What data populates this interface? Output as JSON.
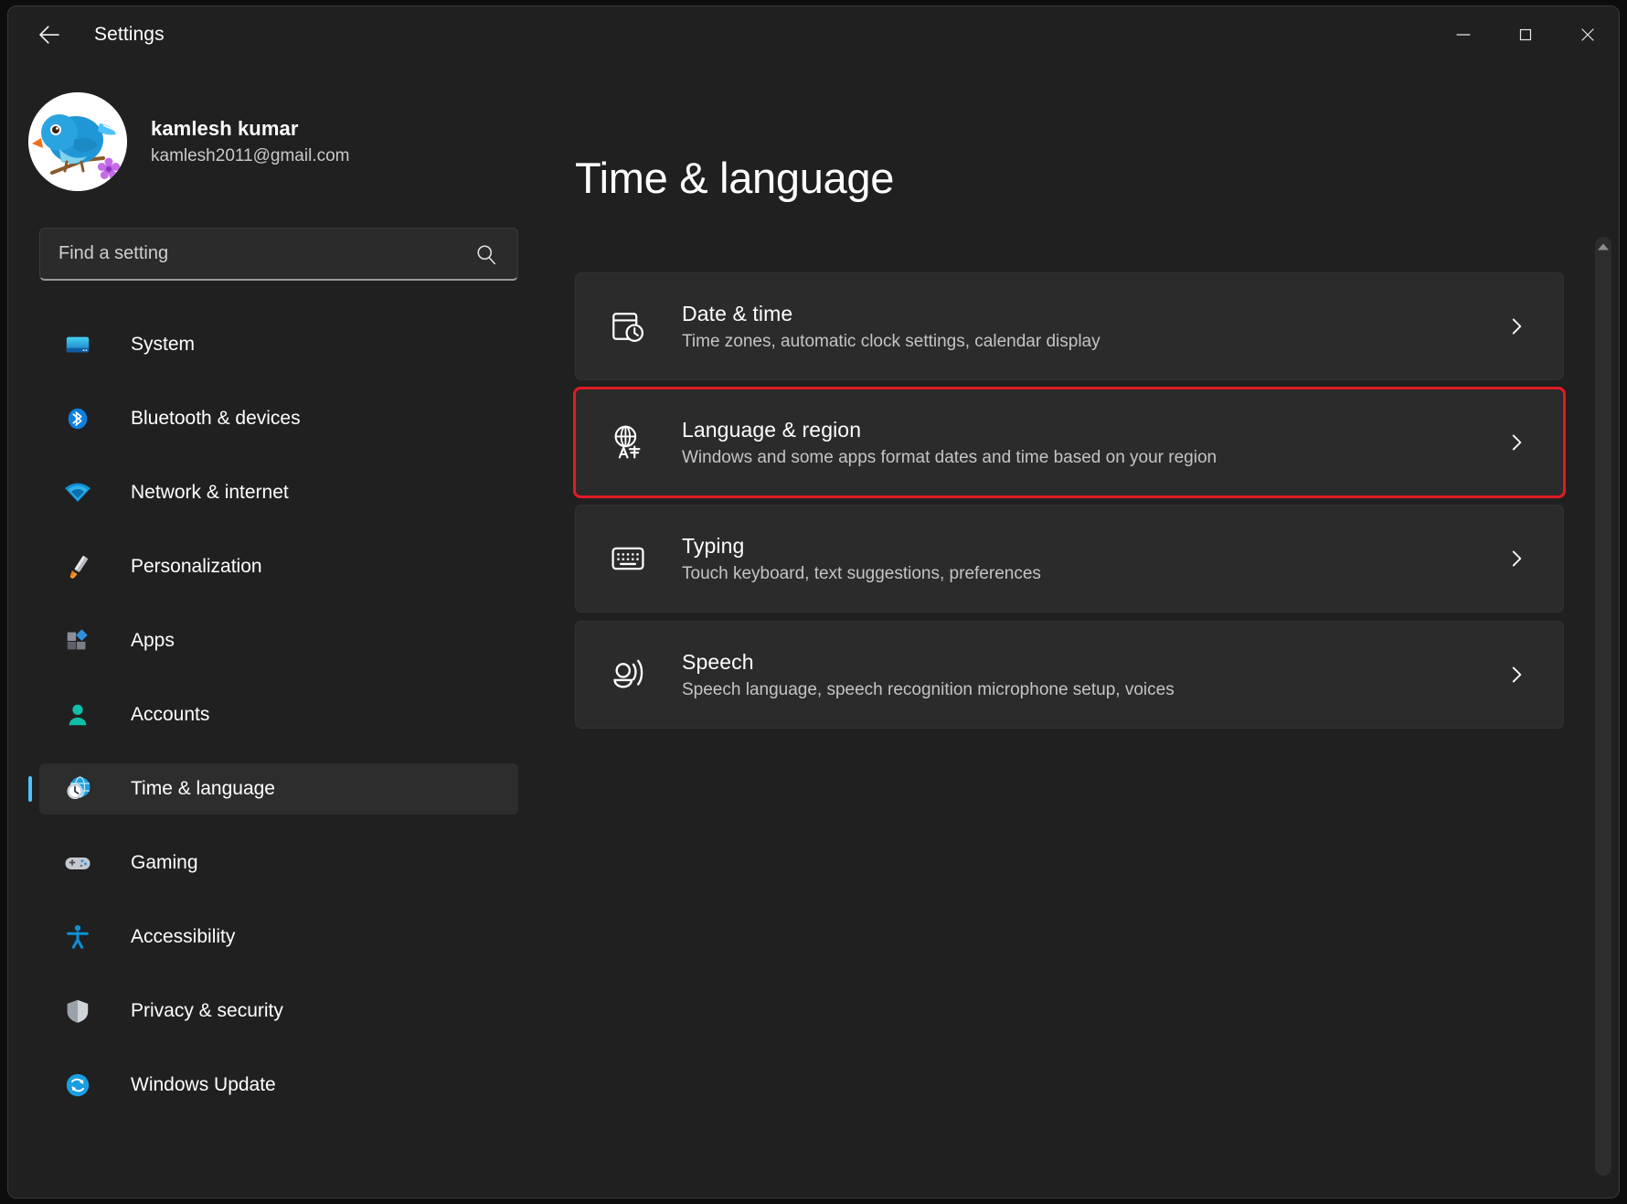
{
  "window": {
    "app_title": "Settings",
    "back_label": "Back",
    "controls": {
      "minimize": "Minimize",
      "maximize": "Maximize",
      "close": "Close"
    }
  },
  "account": {
    "name": "kamlesh kumar",
    "email": "kamlesh2011@gmail.com",
    "avatar_alt": "blue bird avatar"
  },
  "search": {
    "placeholder": "Find a setting",
    "value": ""
  },
  "sidebar": {
    "items": [
      {
        "label": "System",
        "icon": "monitor-icon",
        "selected": false
      },
      {
        "label": "Bluetooth & devices",
        "icon": "bluetooth-icon",
        "selected": false
      },
      {
        "label": "Network & internet",
        "icon": "wifi-icon",
        "selected": false
      },
      {
        "label": "Personalization",
        "icon": "paintbrush-icon",
        "selected": false
      },
      {
        "label": "Apps",
        "icon": "apps-icon",
        "selected": false
      },
      {
        "label": "Accounts",
        "icon": "person-icon",
        "selected": false
      },
      {
        "label": "Time & language",
        "icon": "clock-globe-icon",
        "selected": true
      },
      {
        "label": "Gaming",
        "icon": "gamepad-icon",
        "selected": false
      },
      {
        "label": "Accessibility",
        "icon": "accessibility-icon",
        "selected": false
      },
      {
        "label": "Privacy & security",
        "icon": "shield-icon",
        "selected": false
      },
      {
        "label": "Windows Update",
        "icon": "update-icon",
        "selected": false
      }
    ]
  },
  "main": {
    "page_title": "Time & language",
    "cards": [
      {
        "title": "Date & time",
        "desc": "Time zones, automatic clock settings, calendar display",
        "icon": "calendar-clock-icon",
        "highlighted": false
      },
      {
        "title": "Language & region",
        "desc": "Windows and some apps format dates and time based on your region",
        "icon": "globe-language-icon",
        "highlighted": true
      },
      {
        "title": "Typing",
        "desc": "Touch keyboard, text suggestions, preferences",
        "icon": "keyboard-icon",
        "highlighted": false
      },
      {
        "title": "Speech",
        "desc": "Speech language, speech recognition microphone setup, voices",
        "icon": "speech-icon",
        "highlighted": false
      }
    ]
  },
  "colors": {
    "window_background": "#202020",
    "card_background": "#2b2b2b",
    "accent": "#4cc2ff",
    "highlight_border": "#e01b24",
    "text_primary": "#ffffff",
    "text_secondary": "#c4c4c4"
  }
}
